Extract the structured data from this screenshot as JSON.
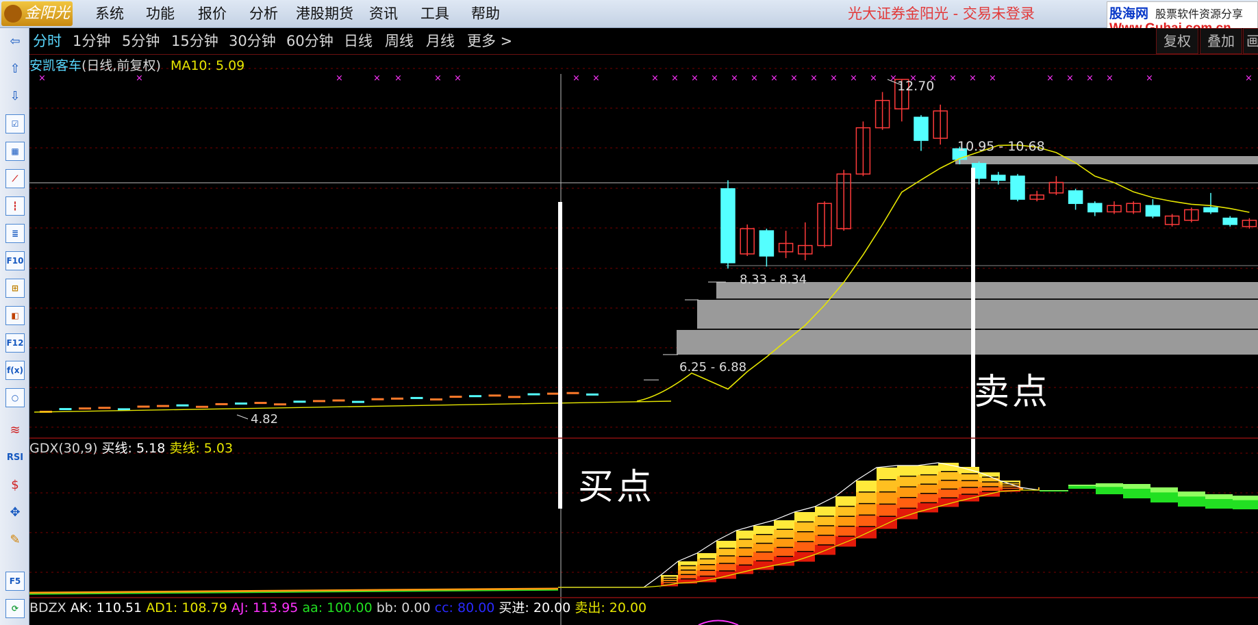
{
  "menu": {
    "logo_text": "金阳光",
    "items": [
      "系统",
      "功能",
      "报价",
      "分析",
      "港股期货",
      "资讯",
      "工具",
      "帮助"
    ],
    "broker_status": "光大证券金阳光 - 交易未登录"
  },
  "watermark": {
    "site": "股海网",
    "slogan": "股票软件资源分享",
    "url": "Www.Guhai.com.cn"
  },
  "periods": [
    "分时",
    "1分钟",
    "5分钟",
    "15分钟",
    "30分钟",
    "60分钟",
    "日线",
    "周线",
    "月线",
    "更多 >"
  ],
  "active_period": "分时",
  "right_buttons": [
    "复权",
    "叠加",
    "画"
  ],
  "toolbar_icons": [
    "left-arrow-icon",
    "up-arrow-icon",
    "down-arrow-icon",
    "list-check-icon",
    "grid-table-icon",
    "line-chart-icon",
    "candlestick-icon",
    "report-icon",
    "f10-icon",
    "tree-icon",
    "self-select-icon",
    "f12-icon",
    "formula-icon",
    "circle-icon",
    "wave-icon",
    "rsi-icon",
    "money-icon",
    "move-icon",
    "pencil-icon",
    "f5-icon",
    "refresh-icon"
  ],
  "toolbar_labels": {
    "f10": "F10",
    "f12": "F12",
    "rsi": "RSI",
    "f5": "F5",
    "fx": "f(x)"
  },
  "main_chart": {
    "stock_name": "安凯客车",
    "period_label": "(日线,前复权)",
    "ma_label": "MA10: 5.09",
    "high_label": "12.70",
    "low_label": "4.82",
    "range_label_1": "10.95 - 10.68",
    "range_label_2": "8.33 - 8.34",
    "range_label_3": "6.25 - 6.88",
    "buy_signal": "买点",
    "sell_signal": "卖点"
  },
  "indicator_1": {
    "name": "GDX(30,9)",
    "buy_line": "买线: 5.18",
    "sell_line": "卖线: 5.03"
  },
  "indicator_2": {
    "name": "BDZX",
    "ak": "AK: 110.51",
    "ad1": "AD1: 108.79",
    "aj": "AJ: 113.95",
    "aa": "aa: 100.00",
    "bb": "bb: 0.00",
    "cc": "cc: 80.00",
    "buy_in": "买进: 20.00",
    "sell_out": "卖出: 20.00"
  },
  "colors": {
    "up": "#ff3b3b",
    "down": "#54ffff",
    "ma": "#e6e600",
    "magenta": "#ff33ff",
    "grid": "#7a0000"
  },
  "chart_data": {
    "type": "candlestick",
    "candles": [
      {
        "o": 10.1,
        "c": 8.34,
        "h": 10.3,
        "l": 8.2
      },
      {
        "o": 8.55,
        "c": 9.15,
        "h": 9.25,
        "l": 8.5
      },
      {
        "o": 9.1,
        "c": 8.5,
        "h": 9.15,
        "l": 8.25
      },
      {
        "o": 8.6,
        "c": 8.8,
        "h": 9.1,
        "l": 8.45
      },
      {
        "o": 8.55,
        "c": 8.75,
        "h": 9.3,
        "l": 8.4
      },
      {
        "o": 8.75,
        "c": 9.75,
        "h": 9.8,
        "l": 8.7
      },
      {
        "o": 9.15,
        "c": 10.45,
        "h": 10.55,
        "l": 9.1
      },
      {
        "o": 10.45,
        "c": 11.55,
        "h": 11.7,
        "l": 10.4
      },
      {
        "o": 11.55,
        "c": 12.2,
        "h": 12.4,
        "l": 11.5
      },
      {
        "o": 12.0,
        "c": 12.7,
        "h": 12.7,
        "l": 11.7
      },
      {
        "o": 11.8,
        "c": 11.25,
        "h": 11.85,
        "l": 11.0
      },
      {
        "o": 11.3,
        "c": 11.95,
        "h": 12.1,
        "l": 11.15
      },
      {
        "o": 11.05,
        "c": 10.8,
        "h": 11.1,
        "l": 10.68
      },
      {
        "o": 10.7,
        "c": 10.35,
        "h": 10.75,
        "l": 10.2
      },
      {
        "o": 10.42,
        "c": 10.3,
        "h": 10.5,
        "l": 10.2
      },
      {
        "o": 10.4,
        "c": 9.85,
        "h": 10.45,
        "l": 9.8
      },
      {
        "o": 9.85,
        "c": 9.95,
        "h": 10.05,
        "l": 9.8
      },
      {
        "o": 10.0,
        "c": 10.25,
        "h": 10.4,
        "l": 9.95
      },
      {
        "o": 10.05,
        "c": 9.75,
        "h": 10.1,
        "l": 9.6
      },
      {
        "o": 9.75,
        "c": 9.55,
        "h": 9.8,
        "l": 9.45
      },
      {
        "o": 9.55,
        "c": 9.7,
        "h": 9.8,
        "l": 9.5
      },
      {
        "o": 9.55,
        "c": 9.75,
        "h": 9.8,
        "l": 9.5
      },
      {
        "o": 9.7,
        "c": 9.45,
        "h": 9.85,
        "l": 9.4
      },
      {
        "o": 9.25,
        "c": 9.45,
        "h": 9.5,
        "l": 9.2
      },
      {
        "o": 9.35,
        "c": 9.6,
        "h": 9.65,
        "l": 9.3
      },
      {
        "o": 9.65,
        "c": 9.55,
        "h": 10.0,
        "l": 9.5
      },
      {
        "o": 9.4,
        "c": 9.25,
        "h": 9.45,
        "l": 9.2
      },
      {
        "o": 9.2,
        "c": 9.35,
        "h": 9.4,
        "l": 9.15
      }
    ]
  }
}
